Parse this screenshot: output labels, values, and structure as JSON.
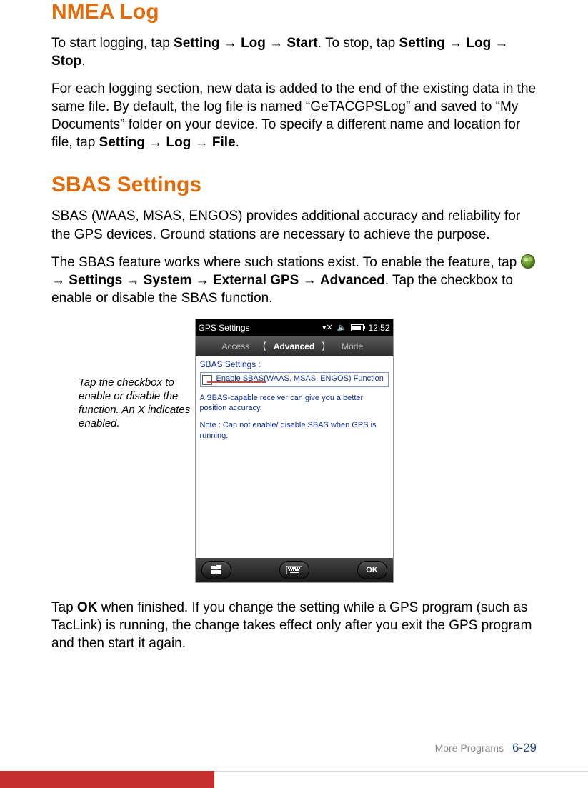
{
  "nmea": {
    "heading": "NMEA Log",
    "p1_a": "To start logging, tap ",
    "p1_b1": "Setting",
    "p1_arr": " → ",
    "p1_b2": "Log",
    "p1_b3": "Start",
    "p1_c": ". To stop, tap ",
    "p1_b4": "Setting",
    "p1_b5": "Log",
    "p1_b6": "Stop",
    "p1_d": ".",
    "p2_a": "For each logging section, new data is added to the end of the existing data in the same file. By default, the log file is named “GeTACGPSLog” and saved to “My Documents” folder on your device. To specify a different name and location for file, tap ",
    "p2_b1": "Setting",
    "p2_b2": "Log",
    "p2_b3": "File",
    "p2_d": "."
  },
  "sbas": {
    "heading": "SBAS Settings",
    "p1": "SBAS (WAAS, MSAS, ENGOS) provides additional accuracy and reliability for the GPS devices. Ground stations are necessary to achieve the purpose.",
    "p2_a": "The SBAS feature works where such stations exist. To enable the feature, tap ",
    "p2_b1": "Settings",
    "p2_b2": "System",
    "p2_b3": "External GPS",
    "p2_b4": "Advanced",
    "p2_c": ". Tap the checkbox to enable or disable the SBAS function.",
    "p3_a": "Tap ",
    "p3_b1": "OK",
    "p3_c": " when finished. If you change the setting while a GPS program (such as TacLink) is running, the change takes effect only after you exit the GPS program and then start it again."
  },
  "callout": "Tap the checkbox to enable or disable the function. An X indicates enabled.",
  "device": {
    "title": "GPS Settings",
    "time": "12:52",
    "tab_left": "Access",
    "tab_active": "Advanced",
    "tab_right": "Mode",
    "sbas_label": "SBAS Settings :",
    "checkbox_label": "Enable SBAS(WAAS, MSAS, ENGOS) Function",
    "desc": "A SBAS-capable receiver can give you a better position accuracy.",
    "note": "Note : Can not enable/ disable SBAS when GPS is running.",
    "ok": "OK"
  },
  "footer": {
    "section": "More Programs",
    "page": "6-29"
  }
}
